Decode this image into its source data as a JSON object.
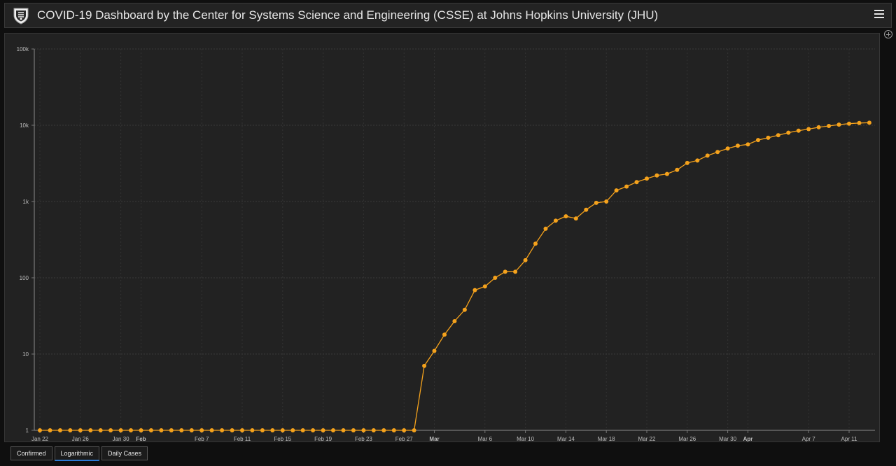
{
  "header": {
    "title": "COVID-19 Dashboard by the Center for Systems Science and Engineering (CSSE) at Johns Hopkins University (JHU)"
  },
  "tabs": [
    {
      "label": "Confirmed"
    },
    {
      "label": "Logarithmic"
    },
    {
      "label": "Daily Cases"
    }
  ],
  "active_tab": 1,
  "colors": {
    "series": "#f5a21c",
    "background": "#222222",
    "grid": "#3a3a3a",
    "active_tab": "#2a7ad6"
  },
  "chart_data": {
    "type": "line",
    "yscale": "log",
    "ylim": [
      1,
      100000
    ],
    "grid": true,
    "y_ticks": [
      {
        "value": 1,
        "label": "1"
      },
      {
        "value": 10,
        "label": "10"
      },
      {
        "value": 100,
        "label": "100"
      },
      {
        "value": 1000,
        "label": "1k"
      },
      {
        "value": 10000,
        "label": "10k"
      },
      {
        "value": 100000,
        "label": "100k"
      }
    ],
    "x_ticks": [
      {
        "date": "2020-01-22",
        "label": "Jan 22",
        "bold": false
      },
      {
        "date": "2020-01-26",
        "label": "Jan 26",
        "bold": false
      },
      {
        "date": "2020-01-30",
        "label": "Jan 30",
        "bold": false
      },
      {
        "date": "2020-02-01",
        "label": "Feb",
        "bold": true
      },
      {
        "date": "2020-02-07",
        "label": "Feb 7",
        "bold": false
      },
      {
        "date": "2020-02-11",
        "label": "Feb 11",
        "bold": false
      },
      {
        "date": "2020-02-15",
        "label": "Feb 15",
        "bold": false
      },
      {
        "date": "2020-02-19",
        "label": "Feb 19",
        "bold": false
      },
      {
        "date": "2020-02-23",
        "label": "Feb 23",
        "bold": false
      },
      {
        "date": "2020-02-27",
        "label": "Feb 27",
        "bold": false
      },
      {
        "date": "2020-03-01",
        "label": "Mar",
        "bold": true
      },
      {
        "date": "2020-03-06",
        "label": "Mar 6",
        "bold": false
      },
      {
        "date": "2020-03-10",
        "label": "Mar 10",
        "bold": false
      },
      {
        "date": "2020-03-14",
        "label": "Mar 14",
        "bold": false
      },
      {
        "date": "2020-03-18",
        "label": "Mar 18",
        "bold": false
      },
      {
        "date": "2020-03-22",
        "label": "Mar 22",
        "bold": false
      },
      {
        "date": "2020-03-26",
        "label": "Mar 26",
        "bold": false
      },
      {
        "date": "2020-03-30",
        "label": "Mar 30",
        "bold": false
      },
      {
        "date": "2020-04-01",
        "label": "Apr",
        "bold": true
      },
      {
        "date": "2020-04-07",
        "label": "Apr 7",
        "bold": false
      },
      {
        "date": "2020-04-11",
        "label": "Apr 11",
        "bold": false
      }
    ],
    "series": [
      {
        "x": [
          "2020-01-22",
          "2020-01-23",
          "2020-01-24",
          "2020-01-25",
          "2020-01-26",
          "2020-01-27",
          "2020-01-28",
          "2020-01-29",
          "2020-01-30",
          "2020-01-31",
          "2020-02-01",
          "2020-02-02",
          "2020-02-03",
          "2020-02-04",
          "2020-02-05",
          "2020-02-06",
          "2020-02-07",
          "2020-02-08",
          "2020-02-09",
          "2020-02-10",
          "2020-02-11",
          "2020-02-12",
          "2020-02-13",
          "2020-02-14",
          "2020-02-15",
          "2020-02-16",
          "2020-02-17",
          "2020-02-18",
          "2020-02-19",
          "2020-02-20",
          "2020-02-21",
          "2020-02-22",
          "2020-02-23",
          "2020-02-24",
          "2020-02-25",
          "2020-02-26",
          "2020-02-27",
          "2020-02-28",
          "2020-02-29",
          "2020-03-01",
          "2020-03-02",
          "2020-03-03",
          "2020-03-04",
          "2020-03-05",
          "2020-03-06",
          "2020-03-07",
          "2020-03-08",
          "2020-03-09",
          "2020-03-10",
          "2020-03-11",
          "2020-03-12",
          "2020-03-13",
          "2020-03-14",
          "2020-03-15",
          "2020-03-16",
          "2020-03-17",
          "2020-03-18",
          "2020-03-19",
          "2020-03-20",
          "2020-03-21",
          "2020-03-22",
          "2020-03-23",
          "2020-03-24",
          "2020-03-25",
          "2020-03-26",
          "2020-03-27",
          "2020-03-28",
          "2020-03-29",
          "2020-03-30",
          "2020-03-31",
          "2020-04-01",
          "2020-04-02",
          "2020-04-03",
          "2020-04-04",
          "2020-04-05",
          "2020-04-06",
          "2020-04-07",
          "2020-04-08",
          "2020-04-09",
          "2020-04-10",
          "2020-04-11",
          "2020-04-12",
          "2020-04-13"
        ],
        "y": [
          1,
          1,
          1,
          1,
          1,
          1,
          1,
          1,
          1,
          1,
          1,
          1,
          1,
          1,
          1,
          1,
          1,
          1,
          1,
          1,
          1,
          1,
          1,
          1,
          1,
          1,
          1,
          1,
          1,
          1,
          1,
          1,
          1,
          1,
          1,
          1,
          1,
          1,
          7,
          11,
          18,
          27,
          38,
          69,
          77,
          100,
          120,
          120,
          170,
          280,
          440,
          560,
          640,
          600,
          780,
          960,
          1000,
          1400,
          1570,
          1800,
          2000,
          2200,
          2300,
          2600,
          3200,
          3450,
          4000,
          4450,
          4950,
          5400,
          5600,
          6400,
          6850,
          7400,
          8000,
          8500,
          8900,
          9400,
          9800,
          10200,
          10500,
          10700,
          10800
        ]
      }
    ]
  }
}
